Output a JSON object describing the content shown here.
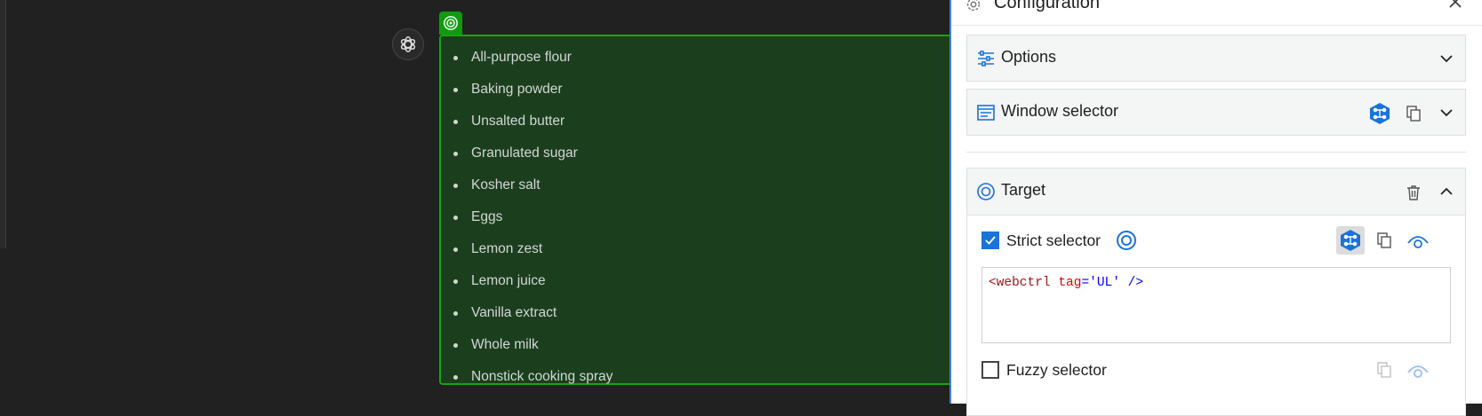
{
  "chat": {
    "ingredients": [
      "All-purpose flour",
      "Baking powder",
      "Unsalted butter",
      "Granulated sugar",
      "Kosher salt",
      "Eggs",
      "Lemon zest",
      "Lemon juice",
      "Vanilla extract",
      "Whole milk",
      "Nonstick cooking spray"
    ]
  },
  "panel": {
    "title": "Configuration",
    "sections": {
      "options": {
        "label": "Options"
      },
      "window_selector": {
        "label": "Window selector"
      },
      "target": {
        "label": "Target",
        "strict_selector": {
          "label": "Strict selector",
          "checked": true,
          "code": {
            "open": "<webctrl",
            "attr": "tag",
            "eq": "=",
            "value": "'UL'",
            "close": "/>"
          }
        },
        "fuzzy_selector": {
          "label": "Fuzzy selector",
          "checked": false
        }
      }
    }
  },
  "colors": {
    "highlight_border": "#19a319",
    "highlight_fill": "#1b3f1d",
    "accent_blue": "#1a73d9",
    "panel_border": "#3b82d6"
  },
  "icons": [
    "openai-logo-icon",
    "target-icon",
    "gear-icon",
    "close-icon",
    "sliders-icon",
    "window-icon",
    "chevron-down-icon",
    "chevron-up-icon",
    "hex-tree-icon",
    "copy-icon",
    "eye-icon",
    "trash-icon",
    "checkmark-icon"
  ]
}
